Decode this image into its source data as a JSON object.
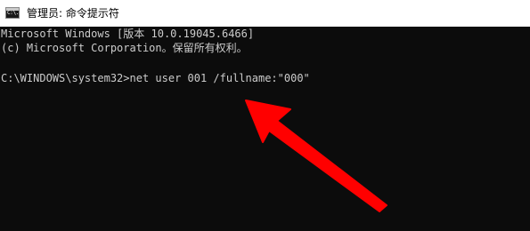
{
  "window": {
    "title": "管理员: 命令提示符",
    "icon": "command-prompt-icon",
    "icon_glyph": "C:\\."
  },
  "console": {
    "lines": [
      "Microsoft Windows [版本 10.0.19045.6466]",
      "(c) Microsoft Corporation。保留所有权利。",
      "C:\\WINDOWS\\system32>net user 001 /fullname:\"000\""
    ]
  },
  "annotation": {
    "icon": "red-arrow-icon",
    "color": "#ff0000"
  },
  "colors": {
    "console_bg": "#0c0c0c",
    "console_text": "#cccccc",
    "titlebar_bg": "#ffffff"
  }
}
